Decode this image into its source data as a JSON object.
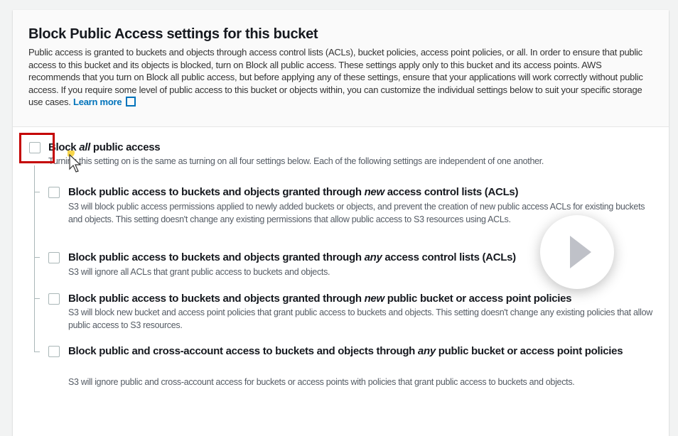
{
  "header": {
    "title": "Block Public Access settings for this bucket",
    "description": "Public access is granted to buckets and objects through access control lists (ACLs), bucket policies, access point policies, or all. In order to ensure that public access to this bucket and its objects is blocked, turn on Block all public access. These settings apply only to this bucket and its access points. AWS recommends that you turn on Block all public access, but before applying any of these settings, ensure that your applications will work correctly without public access. If you require some level of public access to this bucket or objects within, you can customize the individual settings below to suit your specific storage use cases.",
    "learn_more": "Learn more"
  },
  "block_all": {
    "pre": "Block ",
    "em": "all",
    "post": " public access",
    "description": "Turning this setting on is the same as turning on all four settings below. Each of the following settings are independent of one another.",
    "checked": false
  },
  "options": [
    {
      "pre": "Block public access to buckets and objects granted through ",
      "em": "new",
      "post": " access control lists (ACLs)",
      "description": "S3 will block public access permissions applied to newly added buckets or objects, and prevent the creation of new public access ACLs for existing buckets and objects. This setting doesn't change any existing permissions that allow public access to S3 resources using ACLs.",
      "checked": false
    },
    {
      "pre": "Block public access to buckets and objects granted through ",
      "em": "any",
      "post": " access control lists (ACLs)",
      "description": "S3 will ignore all ACLs that grant public access to buckets and objects.",
      "checked": false
    },
    {
      "pre": "Block public access to buckets and objects granted through ",
      "em": "new",
      "post": " public bucket or access point policies",
      "description": "S3 will block new bucket and access point policies that grant public access to buckets and objects. This setting doesn't change any existing policies that allow public access to S3 resources.",
      "checked": false
    },
    {
      "pre": "Block public and cross-account access to buckets and objects through ",
      "em": "any",
      "post": " public bucket or access point policies",
      "description": "S3 will ignore public and cross-account access for buckets or access points with policies that grant public access to buckets and objects.",
      "checked": false
    }
  ],
  "colors": {
    "link": "#0073bb",
    "highlight": "#c40000"
  }
}
